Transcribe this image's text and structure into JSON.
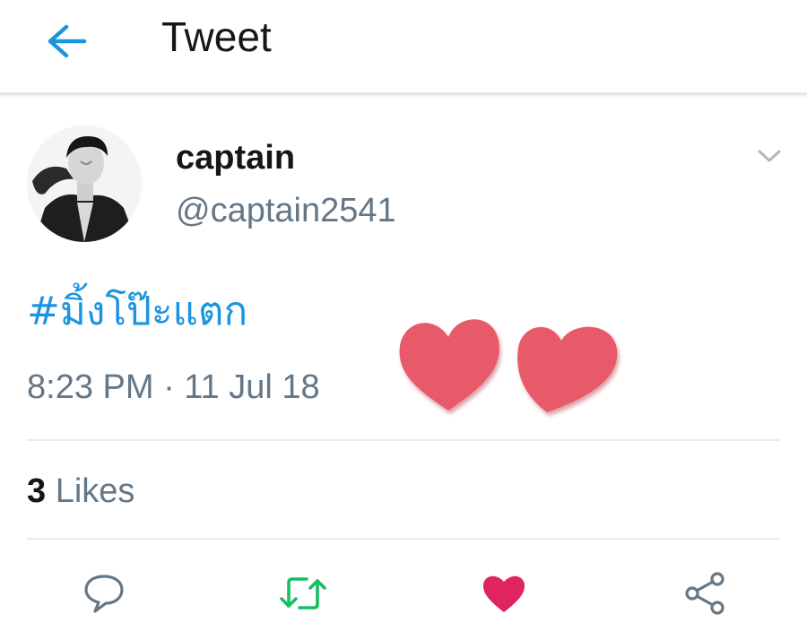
{
  "header": {
    "title": "Tweet",
    "back_icon": "arrow-left-icon",
    "accent": "#1b95e0"
  },
  "author": {
    "name": "captain",
    "handle": "@captain2541",
    "avatar_icon": "profile-photo"
  },
  "tweet": {
    "hashtag": "#มิ้งโป๊ะแตก",
    "timestamp": "8:23 PM · 11 Jul 18",
    "decoration": "two-hearts-sticker"
  },
  "stats": {
    "likes_count": "3",
    "likes_label": "Likes"
  },
  "actions": [
    {
      "name": "reply",
      "icon": "reply-icon",
      "color": "#657786"
    },
    {
      "name": "retweet",
      "icon": "retweet-icon",
      "color": "#17bf63"
    },
    {
      "name": "like",
      "icon": "heart-icon",
      "color": "#e0245e"
    },
    {
      "name": "share",
      "icon": "share-icon",
      "color": "#657786"
    }
  ],
  "colors": {
    "link": "#1b95e0",
    "secondary_text": "#657786",
    "primary_text": "#14171a",
    "divider": "#e6ecf0",
    "retweet_active": "#17bf63",
    "like_active": "#e0245e",
    "sticker_hearts": "#e85a6b"
  }
}
